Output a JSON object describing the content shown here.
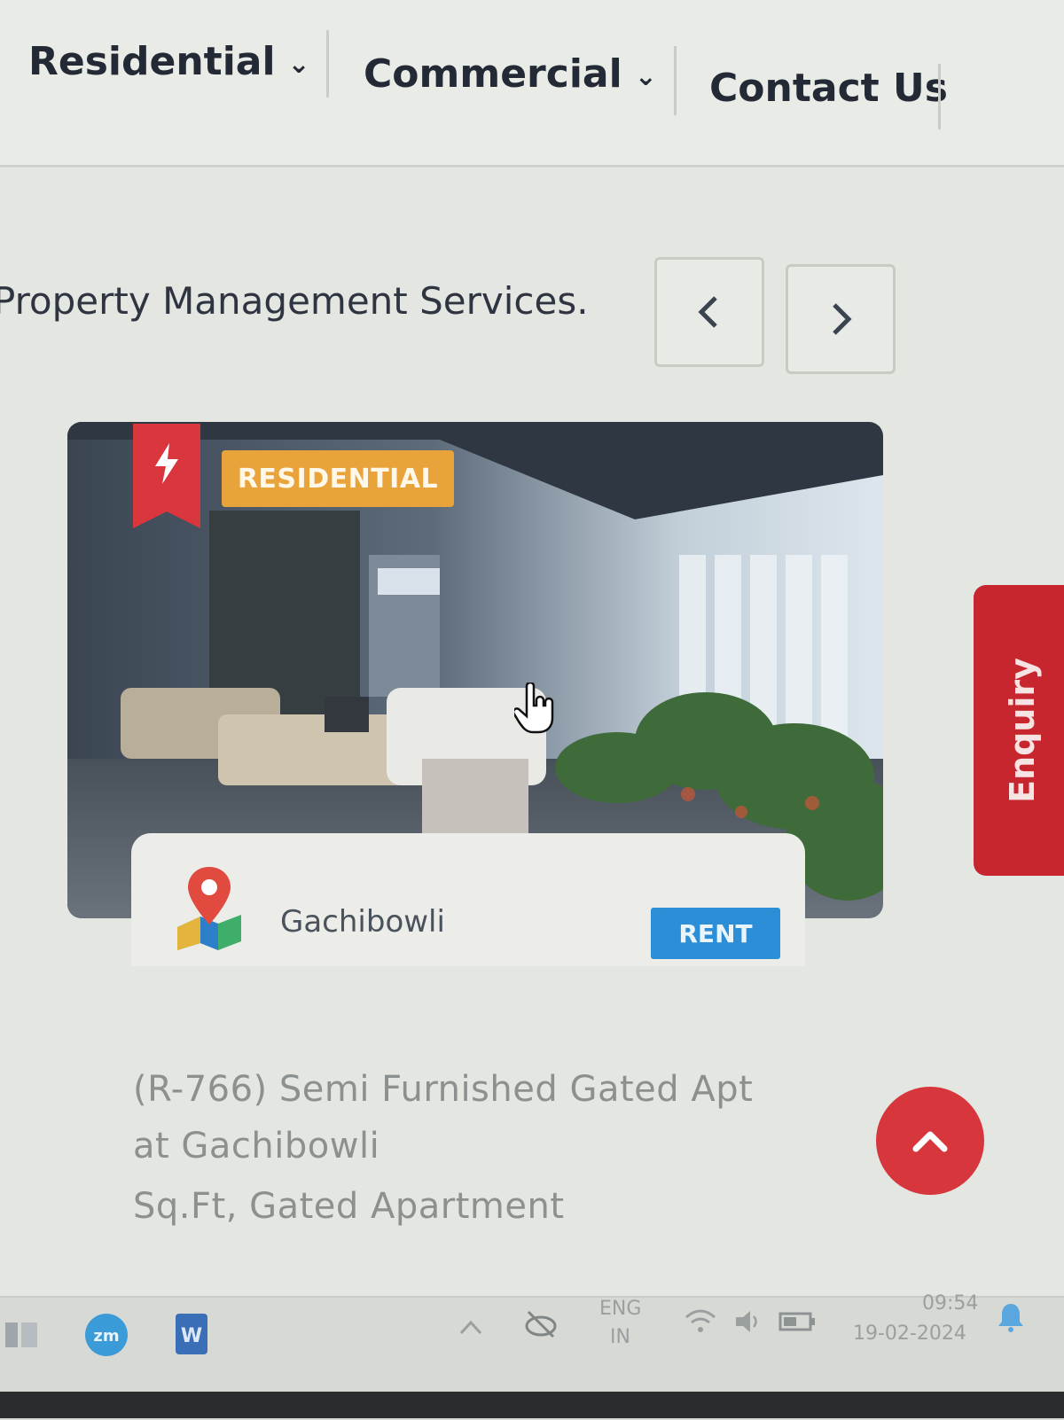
{
  "nav": {
    "items": [
      {
        "label": "Residential",
        "has_dropdown": true
      },
      {
        "label": "Commercial",
        "has_dropdown": true
      },
      {
        "label": "Contact Us",
        "has_dropdown": false
      }
    ]
  },
  "section": {
    "title": "Property Management Services.",
    "prev_icon": "chevron-left-icon",
    "next_icon": "chevron-right-icon"
  },
  "card": {
    "featured_icon": "lightning-icon",
    "type_badge": "RESIDENTIAL",
    "location": "Gachibowli",
    "listing_badge": "RENT",
    "description": [
      "(R-766) Semi Furnished Gated Apt",
      "at Gachibowli",
      "Sq.Ft, Gated Apartment"
    ]
  },
  "floating": {
    "enquiry_label": "Enquiry",
    "scroll_top_icon": "chevron-up-icon"
  },
  "taskbar": {
    "apps": [
      "zoom-icon",
      "word-icon"
    ],
    "language": "ENG",
    "region": "IN",
    "time": "09:54",
    "date": "19-02-2024"
  },
  "colors": {
    "accent_red": "#d9363e",
    "badge_orange": "#e8a33b",
    "badge_blue": "#2b8ed6"
  }
}
